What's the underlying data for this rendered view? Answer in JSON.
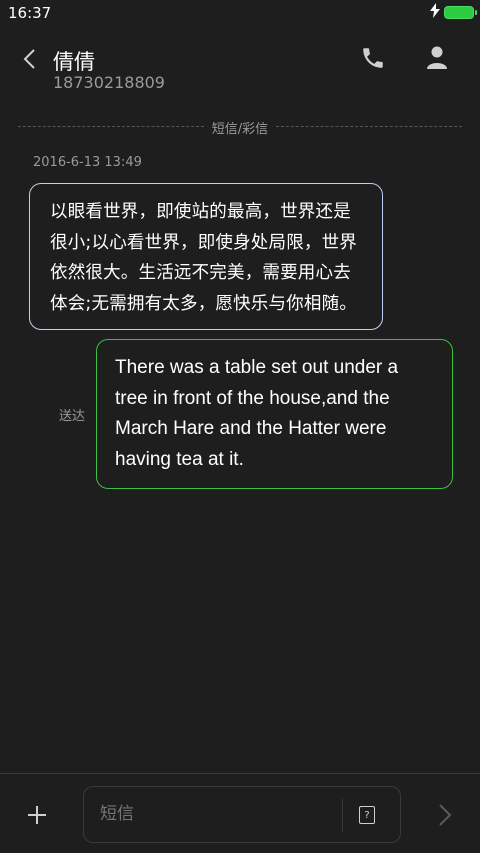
{
  "status_bar": {
    "time": "16:37",
    "charging_icon": "lightning-icon",
    "battery_color": "#2ecc40"
  },
  "header": {
    "contact_name": "倩倩",
    "contact_number": "18730218809",
    "back_icon": "chevron-left-icon",
    "call_icon": "phone-icon",
    "profile_icon": "person-icon"
  },
  "thread": {
    "channel_label": "短信/彩信",
    "timestamp": "2016-6-13 13:49",
    "incoming": {
      "text": "以眼看世界，即使站的最高，世界还是很小;以心看世界，即使身处局限，世界依然很大。生活远不完美，需要用心去体会;无需拥有太多，愿快乐与你相随。",
      "border_color": "#c3ccf2"
    },
    "outgoing": {
      "text": "There was a table set out under a tree in front of the house,and the March Hare and the Hatter were having tea at it.",
      "status": "送达",
      "border_color": "#3fbf3f"
    }
  },
  "composer": {
    "placeholder": "短信",
    "add_icon": "plus-icon",
    "template_icon": "quick-reply-icon",
    "template_glyph": "?",
    "send_icon": "chevron-right-icon"
  }
}
